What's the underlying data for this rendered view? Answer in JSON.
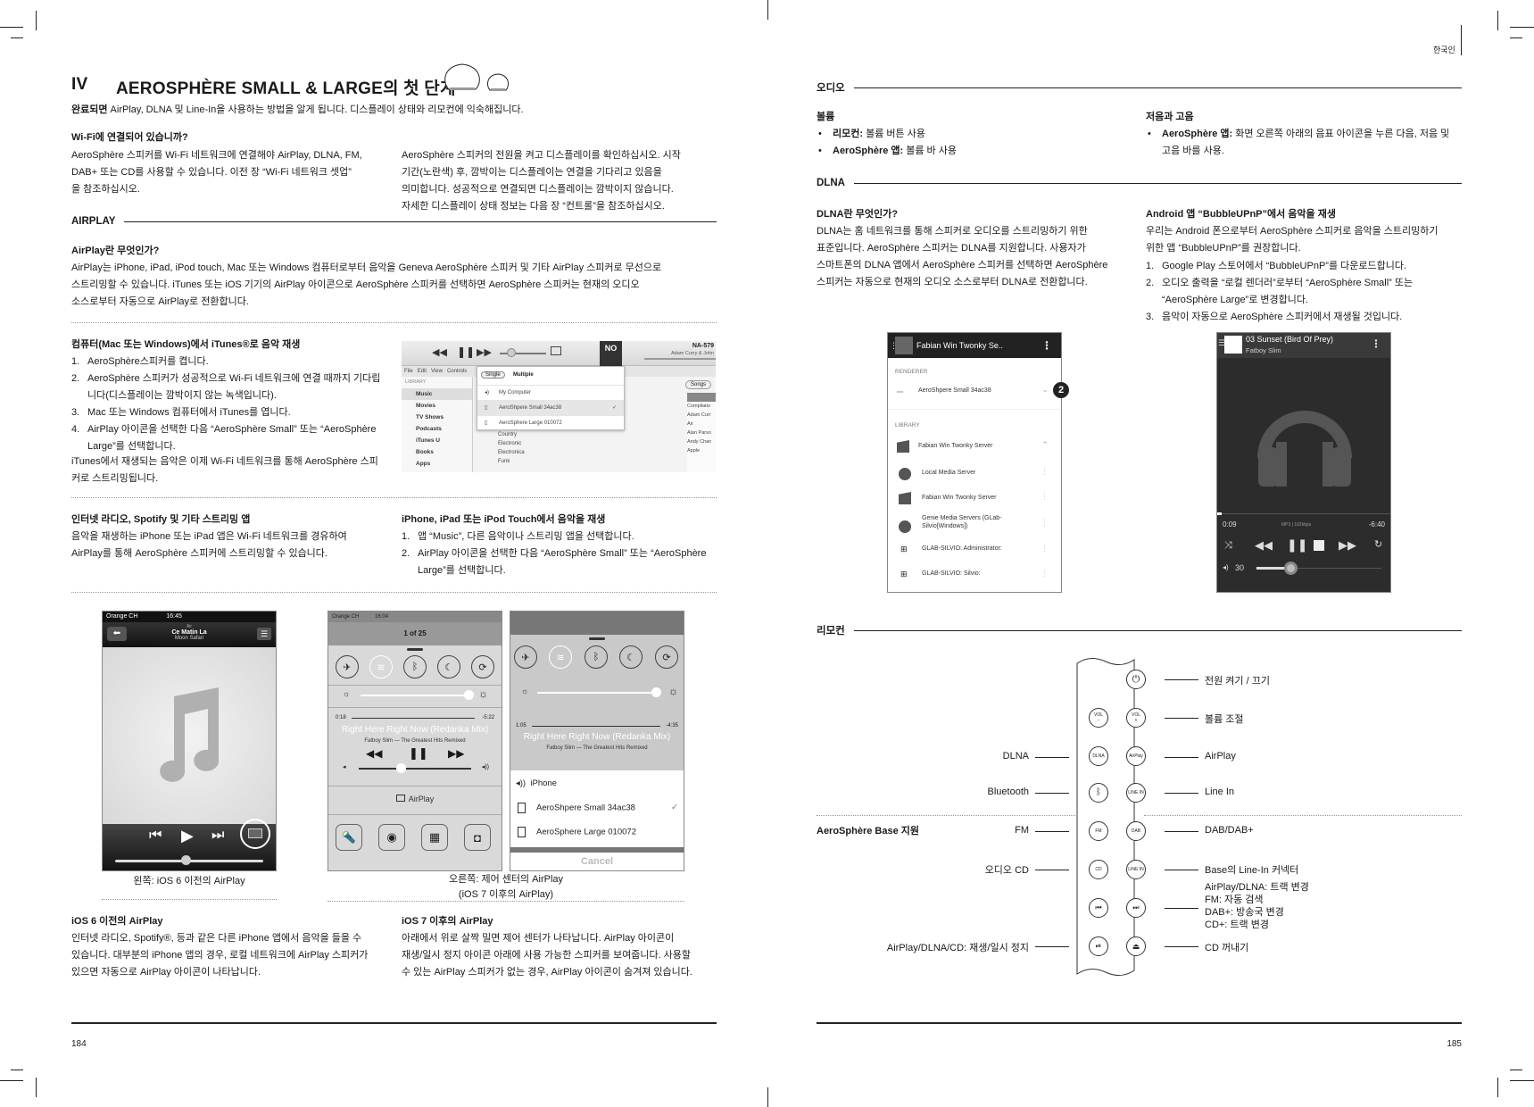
{
  "left_page": {
    "chapter_number": "IV",
    "chapter_title": "AEROSPHÈRE SMALL & LARGE의 첫 단계",
    "intro": {
      "bold": "완료되면",
      "text": " AirPlay, DLNA 및 Line-In을 사용하는 방법을 알게 됩니다. 디스플레이 상태와 리모컨에 익숙해집니다."
    },
    "wifi": {
      "heading": "Wi-Fi에 연결되어 있습니까?",
      "col1": [
        "AeroSphère 스피커를 Wi-Fi 네트워크에 연결해야 AirPlay, DLNA, FM,",
        "DAB+ 또는 CD를 사용할 수 있습니다. 이전 장 “Wi-Fi 네트워크 셋업”",
        "을 참조하십시오."
      ],
      "col2": [
        "AeroSphère 스피커의 전원을 켜고 디스플레이를 확인하십시오. 시작",
        "기간(노란색) 후, 깜박이는 디스플레이는 연결을 기다리고 있음을",
        "의미합니다. 성공적으로 연결되면 디스플레이는 깜박이지 않습니다.",
        "자세한 디스플레이 상태 정보는 다음 장 “컨트롤”을 참조하십시오."
      ]
    },
    "airplay_section": "AIRPLAY",
    "what_is_airplay": {
      "heading": "AirPlay란 무엇인가?",
      "lines": [
        "AirPlay는 iPhone, iPad, iPod touch, Mac 또는 Windows 컴퓨터로부터 음악을 Geneva AeroSphère 스피커 및 기타 AirPlay 스피커로 무선으로",
        "스트리밍할 수 있습니다. iTunes 또는 iOS 기기의 AirPlay 아이콘으로 AeroSphère 스피커를 선택하면 AeroSphère 스피커는 현재의 오디오",
        "소스로부터 자동으로 AirPlay로 전환합니다."
      ]
    },
    "itunes": {
      "heading": "컴퓨터(Mac 또는 Windows)에서 iTunes®로 음악 재생",
      "steps": [
        {
          "n": "1.",
          "text": "AeroSphère스피커를 켭니다."
        },
        {
          "n": "2.",
          "text": "AeroSphère 스피커가 성공적으로 Wi-Fi 네트워크에 연결 때까지 기다립니다(디스플레이는 깜박이지 않는 녹색입니다)."
        },
        {
          "n": "3.",
          "text": "Mac 또는 Windows 컴퓨터에서 iTunes를 엽니다."
        },
        {
          "n": "4.",
          "text": "AirPlay 아이콘을 선택한 다음 “AeroSphère Small” 또는 “AeroSphère Large”를 선택합니다."
        }
      ],
      "footer": "iTunes에서 재생되는 음악은 이제 Wi-Fi 네트워크를 통해 AeroSphère 스피커로 스트리밍됩니다.",
      "screenshot": {
        "menu": [
          "File",
          "Edit",
          "View",
          "Controls"
        ],
        "library_label": "LIBRARY",
        "library_items": [
          "Music",
          "Movies",
          "TV Shows",
          "Podcasts",
          "iTunes U",
          "Books",
          "Apps"
        ],
        "tabs": [
          "Single",
          "Multiple"
        ],
        "devices": [
          "My Computer",
          "AeroShpere Small 34ac38",
          "AeroSphere Large 010072"
        ],
        "selected_check": "✓",
        "genres": [
          "Country",
          "Electronic",
          "Electronica",
          "Funk"
        ],
        "songs_button": "Songs",
        "album_code": "NA-579",
        "artist": "Adam Curry & John",
        "artists": [
          "Compilatio",
          "Adam Curr",
          "Air",
          "Alan Parso",
          "Andy Chan",
          "Apple"
        ],
        "album_art": "NO"
      }
    },
    "streaming_apps": {
      "heading": "인터넷 라디오, Spotify 및 기타 스트리밍 앱",
      "lines": [
        "음악을 재생하는 iPhone 또는 iPad 앱은 Wi-Fi 네트워크를 경유하여",
        "AirPlay를 통해 AeroSphère 스피커에 스트리밍할 수 있습니다."
      ]
    },
    "ios_devices": {
      "heading": "iPhone, iPad 또는 iPod Touch에서 음악을 재생",
      "steps": [
        {
          "n": "1.",
          "text": "앱 “Music”, 다른 음악이나 스트리밍 앱을 선택합니다."
        },
        {
          "n": "2.",
          "text": "AirPlay 아이콘을 선택한 다음 “AeroSphère Small” 또는 “AeroSphère Large”를 선택합니다."
        }
      ]
    },
    "ios6_shot": {
      "carrier": "Orange CH",
      "time": "16:45",
      "artist": "Air",
      "track": "Ce Matin La",
      "album": "Moon Safari",
      "caption": "왼쪽: iOS 6 이전의 AirPlay"
    },
    "ios7_shot": {
      "carrier": "Orange CH",
      "time": "16:04",
      "counter": "1 of 25",
      "elapsed": "0:18",
      "remaining": "-5:22",
      "track": "Right Here Right Now (Redanka Mix)",
      "artist_album": "Fatboy Slim — The Greatest Hits Remixed",
      "airplay_label": "AirPlay",
      "caption_line1": "오른쪽: 제어 센터의 AirPlay",
      "caption_line2": "(iOS 7 이후의 AirPlay)"
    },
    "ios7_picker": {
      "elapsed": "1:05",
      "remaining": "-4:35",
      "track": "Right Here Right Now (Redanka Mix)",
      "artist_album": "Fatboy Slim — The Greatest Hits Remixed",
      "options": [
        "iPhone",
        "AeroShpere Small 34ac38",
        "AeroSphere Large 010072"
      ],
      "cancel": "Cancel"
    },
    "ios6_text": {
      "heading": "iOS 6 이전의 AirPlay",
      "lines": [
        "인터넷 라디오, Spotify®, 등과 같은 다른 iPhone 앱에서 음악을 들을 수",
        "있습니다. 대부분의 iPhone 앱의 경우, 로컬 네트워크에 AirPlay 스피커가",
        "있으면 자동으로 AirPlay 아이콘이 나타납니다."
      ]
    },
    "ios7_text": {
      "heading": "iOS 7 이후의 AirPlay",
      "lines": [
        "아래에서 위로 살짝 밀면 제어 센터가 나타납니다. AirPlay 아이콘이",
        "재생/일시 정지 아이콘 아래에 사용 가능한 스피커를 보여줍니다. 사용할",
        "수 있는 AirPlay 스피커가 없는 경우, AirPlay 아이콘이 숨겨져 있습니다."
      ]
    },
    "page_number": "184"
  },
  "right_page": {
    "language_tab": "한국인",
    "audio_section": "오디오",
    "volume": {
      "heading": "볼륨",
      "bullets": [
        {
          "bold": "리모컨:",
          "text": " 볼륨 버튼 사용"
        },
        {
          "bold": "AeroSphère 앱:",
          "text": " 볼륨 바 사용"
        }
      ]
    },
    "bass_treble": {
      "heading": "저음과 고음",
      "bullets": [
        {
          "bold": "AeroSphère 앱:",
          "text": " 화면 오른쪽 아래의 음표 아이콘을 누른 다음, 저음 및 고음 바를 사용."
        }
      ]
    },
    "dlna_section": "DLNA",
    "what_is_dlna": {
      "heading": "DLNA란 무엇인가?",
      "lines": [
        "DLNA는 홈 네트워크를 통해 스피커로 오디오를 스트리밍하기 위한",
        "표준입니다. AeroSphère 스피커는 DLNA를 지원합니다. 사용자가",
        "스마트폰의 DLNA 앱에서 AeroSphère 스피커를 선택하면 AeroSphère",
        "스피커는 자동으로 현재의 오디오 소스로부터 DLNA로 전환합니다."
      ]
    },
    "bubbleupnp": {
      "heading": "Android 앱 “BubbleUPnP”에서 음악을 재생",
      "intro": [
        "우리는 Android 폰으로부터 AeroSphère 스피커로 음악을 스트리밍하기",
        "위한 앱 “BubbleUPnP”를 권장합니다."
      ],
      "steps": [
        {
          "n": "1.",
          "text": "Google Play 스토어에서 “BubbleUPnP”를 다운로드합니다."
        },
        {
          "n": "2.",
          "text": "오디오 출력을 “로컬 렌더러”로부터 “AeroSphère Small” 또는 “AeroSphère Large”로 변경합니다."
        },
        {
          "n": "3.",
          "text": "음악이 자동으로 AeroSphère 스피커에서 재생될 것입니다."
        }
      ]
    },
    "android_list": {
      "header": "Fabian Win Twonky Se..",
      "renderer_label": "RENDERER",
      "renderer": "AeroShpere Small 34ac38",
      "badge": "2",
      "library_label": "LIBRARY",
      "servers": [
        "Fabian Win Twonky Server",
        "Local Media Server",
        "Fabian Win Twonky Server",
        "Genie Media Servers (GLab-Silvio[Windows])",
        "GLAB-SILVIO: Administrator:",
        "GLAB-SILVIO: Silvio:"
      ]
    },
    "android_player": {
      "track": "03 Sunset (Bird Of Prey)",
      "artist": "Fatboy Slim",
      "elapsed": "0:09",
      "format": "MP3 | 192kbps",
      "remaining": "-6:40",
      "volume": "30",
      "volume_fraction": 0.27
    },
    "remote_section": "리모컨",
    "remote": {
      "base_label": "AeroSphère Base 지원",
      "left_labels": [
        "DLNA",
        "Bluetooth",
        "FM",
        "오디오 CD",
        "AirPlay/DLNA/CD: 재생/일시 정지"
      ],
      "right_labels": [
        "전원 켜기 / 끄기",
        "볼륨 조절",
        "AirPlay",
        "Line In",
        "DAB/DAB+",
        "Base의 Line-In 커넥터"
      ],
      "skip_labels": [
        "AirPlay/DLNA: 트랙 변경",
        "FM: 자동 검색",
        "DAB+: 방송국 변경",
        "CD+: 트랙 변경"
      ],
      "eject_label": "CD 꺼내기",
      "buttons": {
        "power": "⏻",
        "vol_minus": "VOL\n−",
        "vol_plus": "VOL\n+",
        "dlna": "DLNA",
        "airplay": "AirPlay",
        "bluetooth": "ᛒ",
        "line_in": "LINE IN",
        "fm": "FM",
        "dab": "DAB",
        "cd": "CD",
        "line_in_2": "LINE IN",
        "prev": "⏮",
        "next": "⏭",
        "play_pause": "⏯",
        "eject": "⏏"
      }
    },
    "page_number": "185"
  }
}
